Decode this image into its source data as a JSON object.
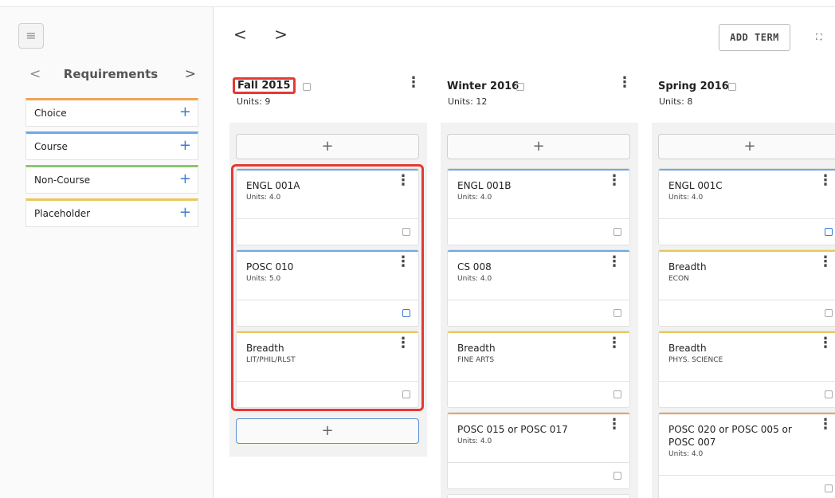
{
  "sidebar": {
    "menu_icon": "menu-icon",
    "title": "Requirements",
    "prev": "<",
    "next": ">",
    "items": [
      {
        "label": "Choice",
        "color": "#f0a35a"
      },
      {
        "label": "Course",
        "color": "#6fa8e6"
      },
      {
        "label": "Non-Course",
        "color": "#8cc56b"
      },
      {
        "label": "Placeholder",
        "color": "#e8c85a"
      }
    ],
    "plus": "+"
  },
  "toolbar": {
    "prev": "<",
    "next": ">",
    "add_term": "ADD TERM",
    "expand_icon": "expand-icon"
  },
  "add_symbol": "+",
  "terms": [
    {
      "title": "Fall 2015",
      "units": "Units:  9",
      "courses": [
        {
          "title": "ENGL 001A",
          "sub": "Units: 4.0",
          "color": "#6fa8e6",
          "note_active": false
        },
        {
          "title": "POSC 010",
          "sub": "Units: 5.0",
          "color": "#6fa8e6",
          "note_active": true
        },
        {
          "title": "Breadth",
          "sub": "LIT/PHIL/RLST",
          "color": "#e8c85a",
          "note_active": false
        }
      ]
    },
    {
      "title": "Winter 2016",
      "units": "Units:  12",
      "courses": [
        {
          "title": "ENGL 001B",
          "sub": "Units: 4.0",
          "color": "#6fa8e6",
          "note_active": false
        },
        {
          "title": "CS 008",
          "sub": "Units: 4.0",
          "color": "#6fa8e6",
          "note_active": false
        },
        {
          "title": "Breadth",
          "sub": "FINE ARTS",
          "color": "#e8c85a",
          "note_active": false
        },
        {
          "title": "POSC 015 or POSC 017",
          "sub": "Units: 4.0",
          "color": "#f0a35a",
          "note_active": false
        }
      ]
    },
    {
      "title": "Spring 2016",
      "units": "Units:  8",
      "courses": [
        {
          "title": "ENGL 001C",
          "sub": "Units: 4.0",
          "color": "#6fa8e6",
          "note_active": true
        },
        {
          "title": "Breadth",
          "sub": "ECON",
          "color": "#e8c85a",
          "note_active": false
        },
        {
          "title": "Breadth",
          "sub": "PHYS. SCIENCE",
          "color": "#e8c85a",
          "note_active": false
        },
        {
          "title": "POSC 020 or POSC 005 or POSC 007",
          "sub": "Units: 4.0",
          "color": "#f0a35a",
          "note_active": false
        }
      ]
    }
  ],
  "colors": {
    "accent": "#3a7bd5",
    "highlight": "#e53935"
  }
}
